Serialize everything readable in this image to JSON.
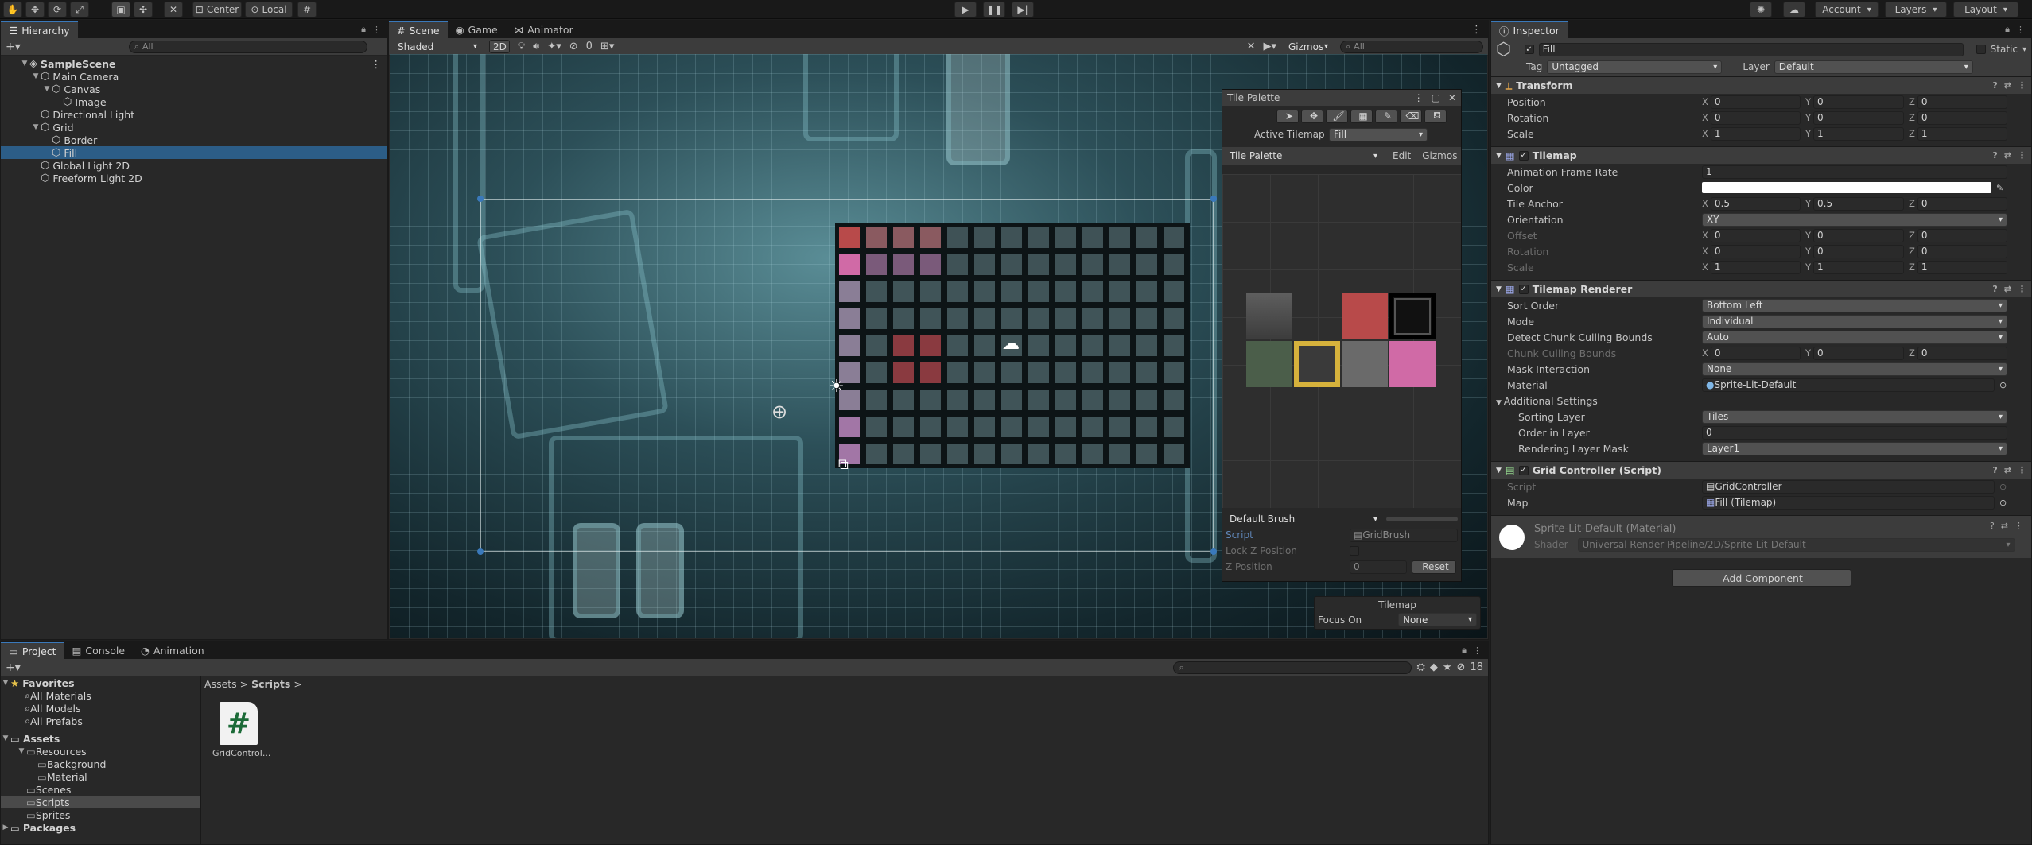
{
  "toolbar": {
    "pivot_center": "Center",
    "pivot_local": "Local",
    "account": "Account",
    "layers": "Layers",
    "layout": "Layout",
    "play_icon": "play-icon",
    "pause_icon": "pause-icon",
    "step_icon": "step-icon"
  },
  "hierarchy": {
    "tab": "Hierarchy",
    "search_placeholder": "All",
    "items": [
      {
        "label": "SampleScene",
        "depth": 0
      },
      {
        "label": "Main Camera",
        "depth": 1
      },
      {
        "label": "Canvas",
        "depth": 2
      },
      {
        "label": "Image",
        "depth": 3
      },
      {
        "label": "Directional Light",
        "depth": 1
      },
      {
        "label": "Grid",
        "depth": 1
      },
      {
        "label": "Border",
        "depth": 2
      },
      {
        "label": "Fill",
        "depth": 2
      },
      {
        "label": "Global Light 2D",
        "depth": 1
      },
      {
        "label": "Freeform Light 2D",
        "depth": 1
      }
    ]
  },
  "scene": {
    "tabs": [
      "Scene",
      "Game",
      "Animator"
    ],
    "shading": "Shaded",
    "mode_2d": "2D",
    "hidden_count": "0",
    "gizmos": "Gizmos",
    "search_placeholder": "All"
  },
  "tile_palette": {
    "title": "Tile Palette",
    "active_tilemap_label": "Active Tilemap",
    "active_tilemap_value": "Fill",
    "palette_dropdown": "Tile Palette",
    "edit": "Edit",
    "gizmos": "Gizmos",
    "brush": "Default Brush",
    "script_label": "Script",
    "script_value": "GridBrush",
    "lock_z_label": "Lock Z Position",
    "z_position_label": "Z Position",
    "z_position_value": "0",
    "reset": "Reset"
  },
  "tilemap_overlay": {
    "title": "Tilemap",
    "focus_on_label": "Focus On",
    "focus_on_value": "None"
  },
  "inspector": {
    "tab": "Inspector",
    "object_name": "Fill",
    "static_label": "Static",
    "tag_label": "Tag",
    "tag_value": "Untagged",
    "layer_label": "Layer",
    "layer_value": "Default",
    "transform": {
      "title": "Transform",
      "position_label": "Position",
      "position": [
        "0",
        "0",
        "0"
      ],
      "rotation_label": "Rotation",
      "rotation": [
        "0",
        "0",
        "0"
      ],
      "scale_label": "Scale",
      "scale": [
        "1",
        "1",
        "1"
      ]
    },
    "tilemap": {
      "title": "Tilemap",
      "frame_rate_label": "Animation Frame Rate",
      "frame_rate": "1",
      "color_label": "Color",
      "anchor_label": "Tile Anchor",
      "anchor": [
        "0.5",
        "0.5",
        "0"
      ],
      "orientation_label": "Orientation",
      "orientation": "XY",
      "offset_label": "Offset",
      "offset": [
        "0",
        "0",
        "0"
      ],
      "rotation_label": "Rotation",
      "rotation": [
        "0",
        "0",
        "0"
      ],
      "scale_label": "Scale",
      "scale": [
        "1",
        "1",
        "1"
      ]
    },
    "renderer": {
      "title": "Tilemap Renderer",
      "sort_order_label": "Sort Order",
      "sort_order": "Bottom Left",
      "mode_label": "Mode",
      "mode": "Individual",
      "culling_label": "Detect Chunk Culling Bounds",
      "culling": "Auto",
      "chunk_bounds_label": "Chunk Culling Bounds",
      "chunk_bounds": [
        "0",
        "0",
        "0"
      ],
      "mask_label": "Mask Interaction",
      "mask": "None",
      "material_label": "Material",
      "material": "Sprite-Lit-Default",
      "additional_label": "Additional Settings",
      "sorting_layer_label": "Sorting Layer",
      "sorting_layer": "Tiles",
      "order_label": "Order in Layer",
      "order": "0",
      "rendering_mask_label": "Rendering Layer Mask",
      "rendering_mask": "Layer1"
    },
    "grid_controller": {
      "title": "Grid Controller (Script)",
      "script_label": "Script",
      "script": "GridController",
      "map_label": "Map",
      "map": "Fill (Tilemap)"
    },
    "material": {
      "title": "Sprite-Lit-Default (Material)",
      "shader_label": "Shader",
      "shader": "Universal Render Pipeline/2D/Sprite-Lit-Default"
    },
    "add_component": "Add Component"
  },
  "project": {
    "tabs": [
      "Project",
      "Console",
      "Animation"
    ],
    "count": "18",
    "favorites_label": "Favorites",
    "favorites": [
      "All Materials",
      "All Models",
      "All Prefabs"
    ],
    "assets_label": "Assets",
    "folders": [
      {
        "label": "Resources",
        "depth": 1
      },
      {
        "label": "Background",
        "depth": 2
      },
      {
        "label": "Material",
        "depth": 2
      },
      {
        "label": "Scenes",
        "depth": 1
      },
      {
        "label": "Scripts",
        "depth": 1
      },
      {
        "label": "Sprites",
        "depth": 1
      }
    ],
    "packages_label": "Packages",
    "breadcrumb": [
      "Assets",
      "Scripts"
    ],
    "file_name": "GridControl...",
    "file_icon_glyph": "#"
  },
  "colors": {
    "accent": "#3a79bb",
    "selection": "#2c5d87",
    "panel": "#282828",
    "tile_red": "#b84a4a",
    "tile_pink": "#d06aa6"
  }
}
